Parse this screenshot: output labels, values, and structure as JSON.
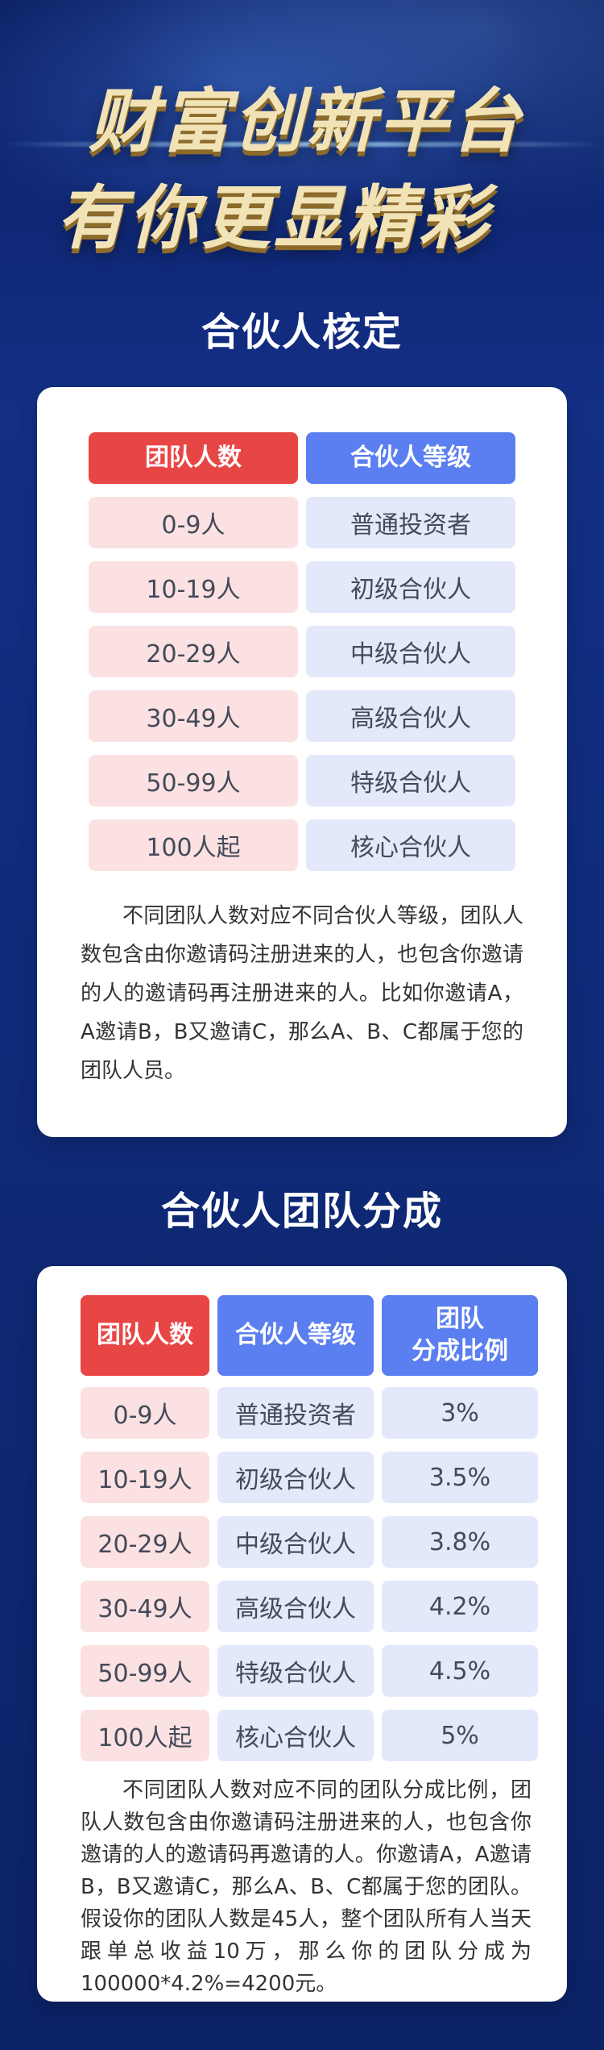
{
  "hero": {
    "line1": "财富创新平台",
    "line2": "有你更显精彩"
  },
  "section1": {
    "title": "合伙人核定",
    "headers": [
      "团队人数",
      "合伙人等级"
    ],
    "rows": [
      [
        "0-9人",
        "普通投资者"
      ],
      [
        "10-19人",
        "初级合伙人"
      ],
      [
        "20-29人",
        "中级合伙人"
      ],
      [
        "30-49人",
        "高级合伙人"
      ],
      [
        "50-99人",
        "特级合伙人"
      ],
      [
        "100人起",
        "核心合伙人"
      ]
    ],
    "description": "不同团队人数对应不同合伙人等级，团队人数包含由你邀请码注册进来的人，也包含你邀请的人的邀请码再注册进来的人。比如你邀请A，A邀请B，B又邀请C，那么A、B、C都属于您的团队人员。"
  },
  "section2": {
    "title": "合伙人团队分成",
    "headers": [
      "团队人数",
      "合伙人等级",
      "团队\n分成比例"
    ],
    "rows": [
      [
        "0-9人",
        "普通投资者",
        "3%"
      ],
      [
        "10-19人",
        "初级合伙人",
        "3.5%"
      ],
      [
        "20-29人",
        "中级合伙人",
        "3.8%"
      ],
      [
        "30-49人",
        "高级合伙人",
        "4.2%"
      ],
      [
        "50-99人",
        "特级合伙人",
        "4.5%"
      ],
      [
        "100人起",
        "核心合伙人",
        "5%"
      ]
    ],
    "description": "不同团队人数对应不同的团队分成比例，团队人数包含由你邀请码注册进来的人，也包含你邀请的人的邀请码再邀请的人。你邀请A，A邀请B，B又邀请C，那么A、B、C都属于您的团队。假设你的团队人数是45人，整个团队所有人当天跟单总收益10万，那么你的团队分成为100000*4.2%=4200元。"
  }
}
